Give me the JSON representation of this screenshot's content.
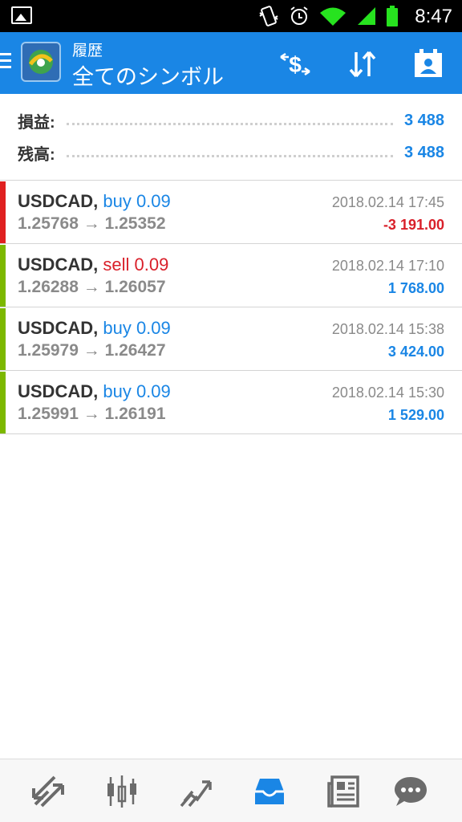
{
  "status_bar": {
    "time": "8:47",
    "icons": [
      "image-icon",
      "vibrate-icon",
      "alarm-icon",
      "wifi-icon",
      "signal-icon",
      "battery-icon"
    ]
  },
  "app_bar": {
    "subtitle": "履歴",
    "title": "全てのシンボル",
    "color": "#1a86e5",
    "actions": [
      "currency-exchange-icon",
      "sort-icon",
      "contact-calendar-icon"
    ]
  },
  "summary": {
    "profit_label": "損益:",
    "profit_value": "3 488",
    "balance_label": "残高:",
    "balance_value": "3 488"
  },
  "deals": [
    {
      "symbol": "USDCAD,",
      "direction": "buy 0.09",
      "open": "1.25768",
      "arrow": "→",
      "close": "1.25352",
      "date": "2018.02.14 17:45",
      "pl": "-3 191.00",
      "bar_color": "#e02020",
      "dir_color": "#1a86e5",
      "pl_color": "#d9202a"
    },
    {
      "symbol": "USDCAD,",
      "direction": "sell 0.09",
      "open": "1.26288",
      "arrow": "→",
      "close": "1.26057",
      "date": "2018.02.14 17:10",
      "pl": "1 768.00",
      "bar_color": "#7cb800",
      "dir_color": "#d9202a",
      "pl_color": "#1a86e5"
    },
    {
      "symbol": "USDCAD,",
      "direction": "buy 0.09",
      "open": "1.25979",
      "arrow": "→",
      "close": "1.26427",
      "date": "2018.02.14 15:38",
      "pl": "3 424.00",
      "bar_color": "#7cb800",
      "dir_color": "#1a86e5",
      "pl_color": "#1a86e5"
    },
    {
      "symbol": "USDCAD,",
      "direction": "buy 0.09",
      "open": "1.25991",
      "arrow": "→",
      "close": "1.26191",
      "date": "2018.02.14 15:30",
      "pl": "1 529.00",
      "bar_color": "#7cb800",
      "dir_color": "#1a86e5",
      "pl_color": "#1a86e5"
    }
  ],
  "bottom_nav": [
    "quotes-icon",
    "chart-icon",
    "trade-icon",
    "history-icon",
    "news-icon",
    "chat-icon"
  ]
}
